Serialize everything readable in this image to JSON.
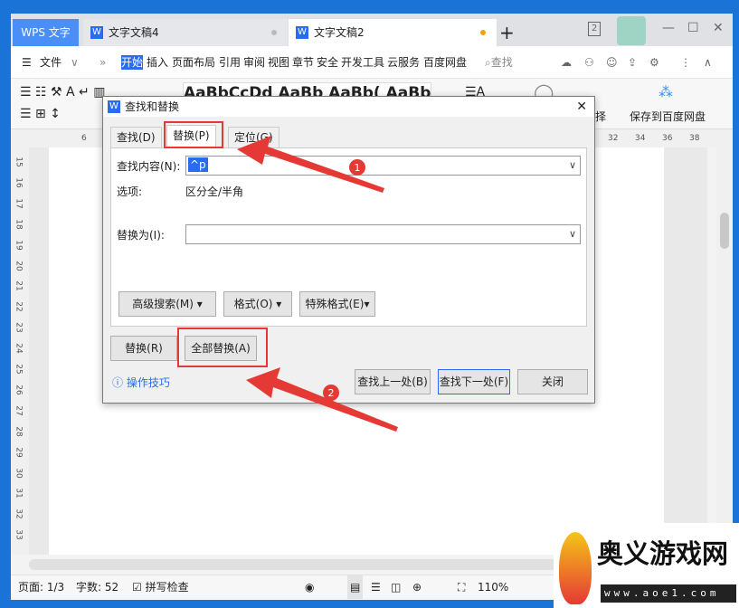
{
  "app": {
    "brand_tab": "WPS 文字",
    "tabs": [
      {
        "label": "文字文稿4",
        "dot_color": "#bbbbbb"
      },
      {
        "label": "文字文稿2",
        "dot_color": "#f0a30a"
      }
    ],
    "new_tab": "+",
    "window_count": "2"
  },
  "menu": {
    "file": "文件",
    "items": [
      "开始",
      "插入",
      "页面布局",
      "引用",
      "审阅",
      "视图",
      "章节",
      "安全",
      "开发工具",
      "云服务",
      "百度网盘"
    ],
    "search": "查找"
  },
  "ribbon": {
    "style_preview": "AaBbCcDd AaBb AaBb( AaBbC",
    "save_baidu": "保存到百度网盘",
    "select_partial": "择"
  },
  "ruler": {
    "h_ticks": [
      "6",
      "32",
      "34",
      "36",
      "38"
    ],
    "v_ticks": [
      "15",
      "16",
      "17",
      "18",
      "19",
      "20",
      "21",
      "22",
      "23",
      "24",
      "25",
      "26",
      "27",
      "28",
      "29",
      "30",
      "31",
      "32",
      "33"
    ]
  },
  "dialog": {
    "title": "查找和替换",
    "tabs": [
      "查找(D)",
      "替换(P)",
      "定位(G)"
    ],
    "active_tab": "替换(P)",
    "find_label": "查找内容(N):",
    "find_value": "^p",
    "options_label": "选项:",
    "options_value": "区分全/半角",
    "replace_label": "替换为(I):",
    "replace_value": "",
    "advanced": "高级搜索(M)",
    "format": "格式(O)",
    "special": "特殊格式(E)",
    "replace_btn": "替换(R)",
    "replace_all_btn": "全部替换(A)",
    "tips": "操作技巧",
    "find_prev": "查找上一处(B)",
    "find_next": "查找下一处(F)",
    "close": "关闭"
  },
  "annotations": [
    "1",
    "2"
  ],
  "status": {
    "page": "页面: 1/3",
    "words": "字数: 52",
    "spell": "拼写检查",
    "zoom": "110%"
  },
  "watermark": {
    "name": "奥义游戏网",
    "url": "www.aoe1.com"
  },
  "colors": {
    "accent": "#2b6bef",
    "annotation": "#e53935",
    "desktop": "#1a73d6"
  }
}
